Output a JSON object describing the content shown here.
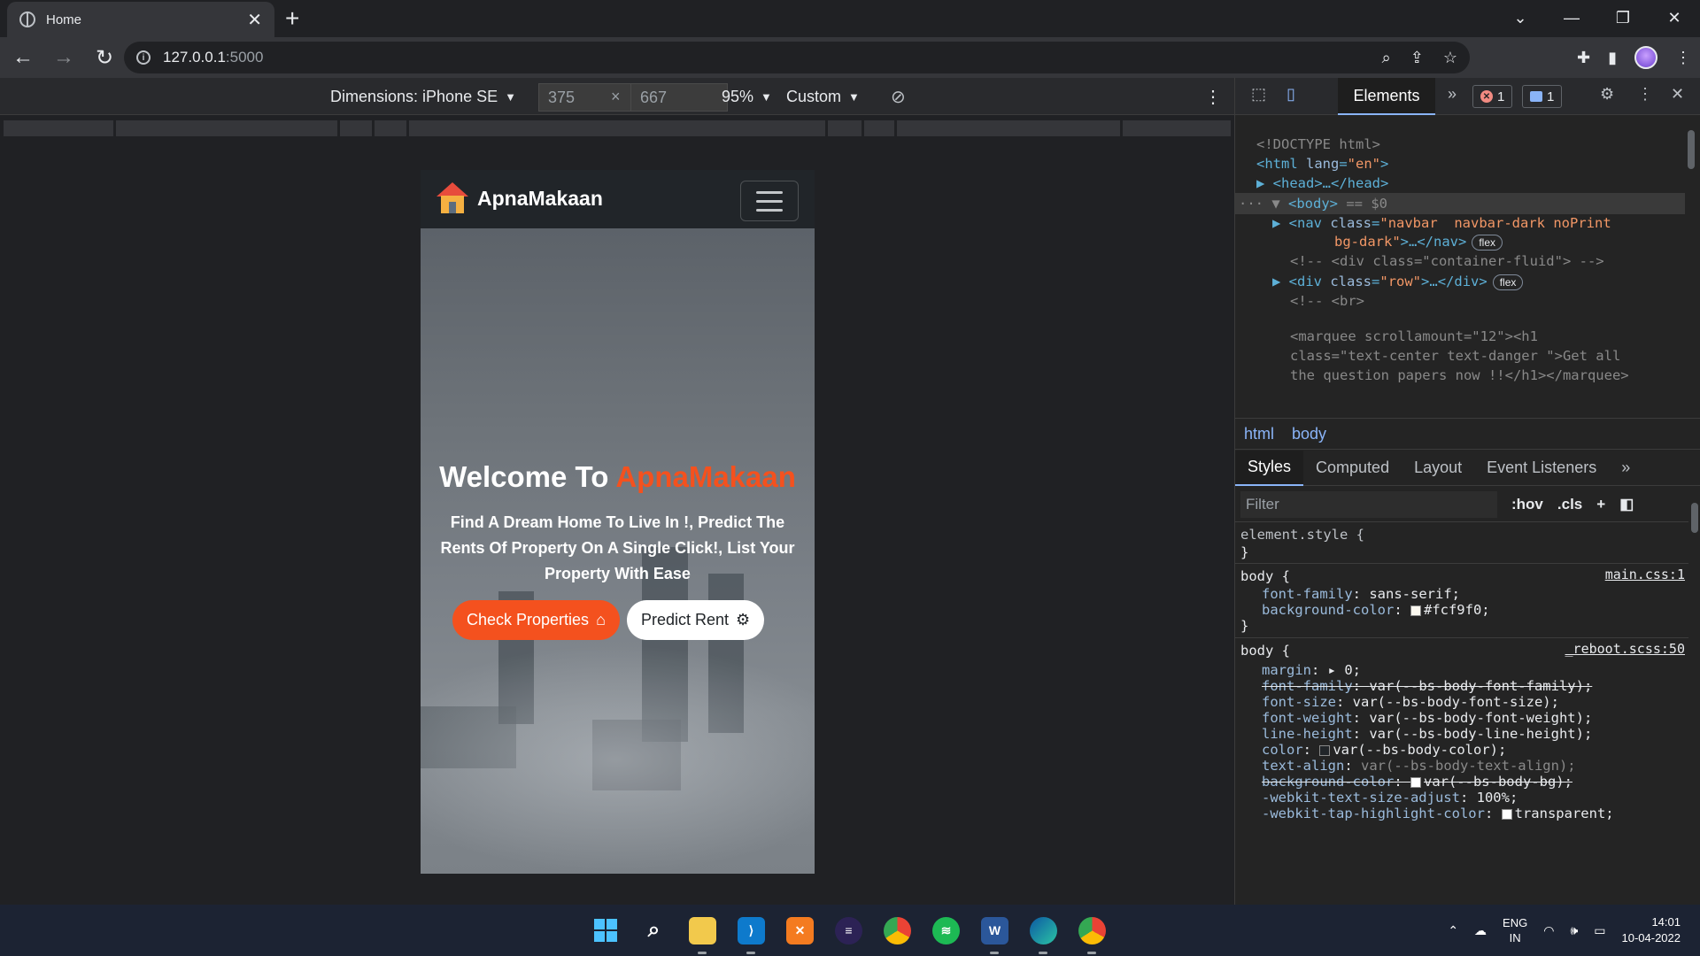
{
  "browser": {
    "tab_title": "Home",
    "url_host": "127.0.0.1",
    "url_port": ":5000"
  },
  "device_toolbar": {
    "dimensions_label": "Dimensions: iPhone SE",
    "width_value": "375",
    "height_value": "667",
    "times": "×",
    "zoom": "95%",
    "throttle": "Custom"
  },
  "site": {
    "brand": "ApnaMakaan",
    "hero_title_prefix": "Welcome To ",
    "hero_title_accent": "ApnaMakaan",
    "hero_subtitle": "Find A Dream Home To Live In !, Predict The Rents Of Property On A Single Click!, List Your Property With Ease",
    "btn_check": "Check Properties",
    "btn_predict": "Predict Rent",
    "accent_color": "#f4511e"
  },
  "devtools": {
    "active_tab": "Elements",
    "error_count": "1",
    "message_count": "1",
    "dom": {
      "l1": "<!DOCTYPE html>",
      "l2_open": "<html ",
      "l2_attr": "lang",
      "l2_val": "\"en\"",
      "l2_close": ">",
      "l3": "<head>…</head>",
      "l4_tag": "<body>",
      "l4_eq": " == $0",
      "l5_tag": "<nav ",
      "l5_attr": "class",
      "l5_val": "\"navbar  navbar-dark noPrint",
      "l6_val": "bg-dark\"",
      "l6_close": ">…</nav>",
      "flex": "flex",
      "l7": "<!-- <div class=\"container-fluid\"> -->",
      "l8_tag": "<div ",
      "l8_attr": "class",
      "l8_val": "\"row\"",
      "l8_close": ">…</div>",
      "l9": "<!-- <br>",
      "l10": "<marquee scrollamount=\"12\"><h1",
      "l11": "class=\"text-center text-danger \">Get all",
      "l12": "the question papers now !!</h1></marquee>"
    },
    "crumbs": [
      "html",
      "body"
    ],
    "style_tabs": [
      "Styles",
      "Computed",
      "Layout",
      "Event Listeners"
    ],
    "filter_placeholder": "Filter",
    "hov": ":hov",
    "cls": ".cls",
    "rules": {
      "element_style": "element.style {",
      "close": "}",
      "body1_sel": "body {",
      "body1_src": "main.css:1",
      "body1_p1": "font-family",
      "body1_v1": "sans-serif;",
      "body1_p2": "background-color",
      "body1_v2": "#fcf9f0;",
      "body2_sel": "body {",
      "body2_src": "_reboot.scss:50",
      "p_margin": "margin",
      "v_margin": "0;",
      "p_ff": "font-family",
      "v_ff": "var(--bs-body-font-family);",
      "p_fs": "font-size",
      "v_fs": "var(--bs-body-font-size);",
      "p_fw": "font-weight",
      "v_fw": "var(--bs-body-font-weight);",
      "p_lh": "line-height",
      "v_lh": "var(--bs-body-line-height);",
      "p_color": "color",
      "v_color": "var(--bs-body-color);",
      "p_ta": "text-align",
      "v_ta": "var(--bs-body-text-align);",
      "p_bg": "background-color",
      "v_bg": "var(--bs-body-bg);",
      "p_wtsa": "-webkit-text-size-adjust",
      "v_wtsa": "100%;",
      "p_wthc": "-webkit-tap-highlight-color",
      "v_wthc": "transparent;"
    }
  },
  "taskbar": {
    "lang1": "ENG",
    "lang2": "IN",
    "time": "14:01",
    "date": "10-04-2022"
  }
}
